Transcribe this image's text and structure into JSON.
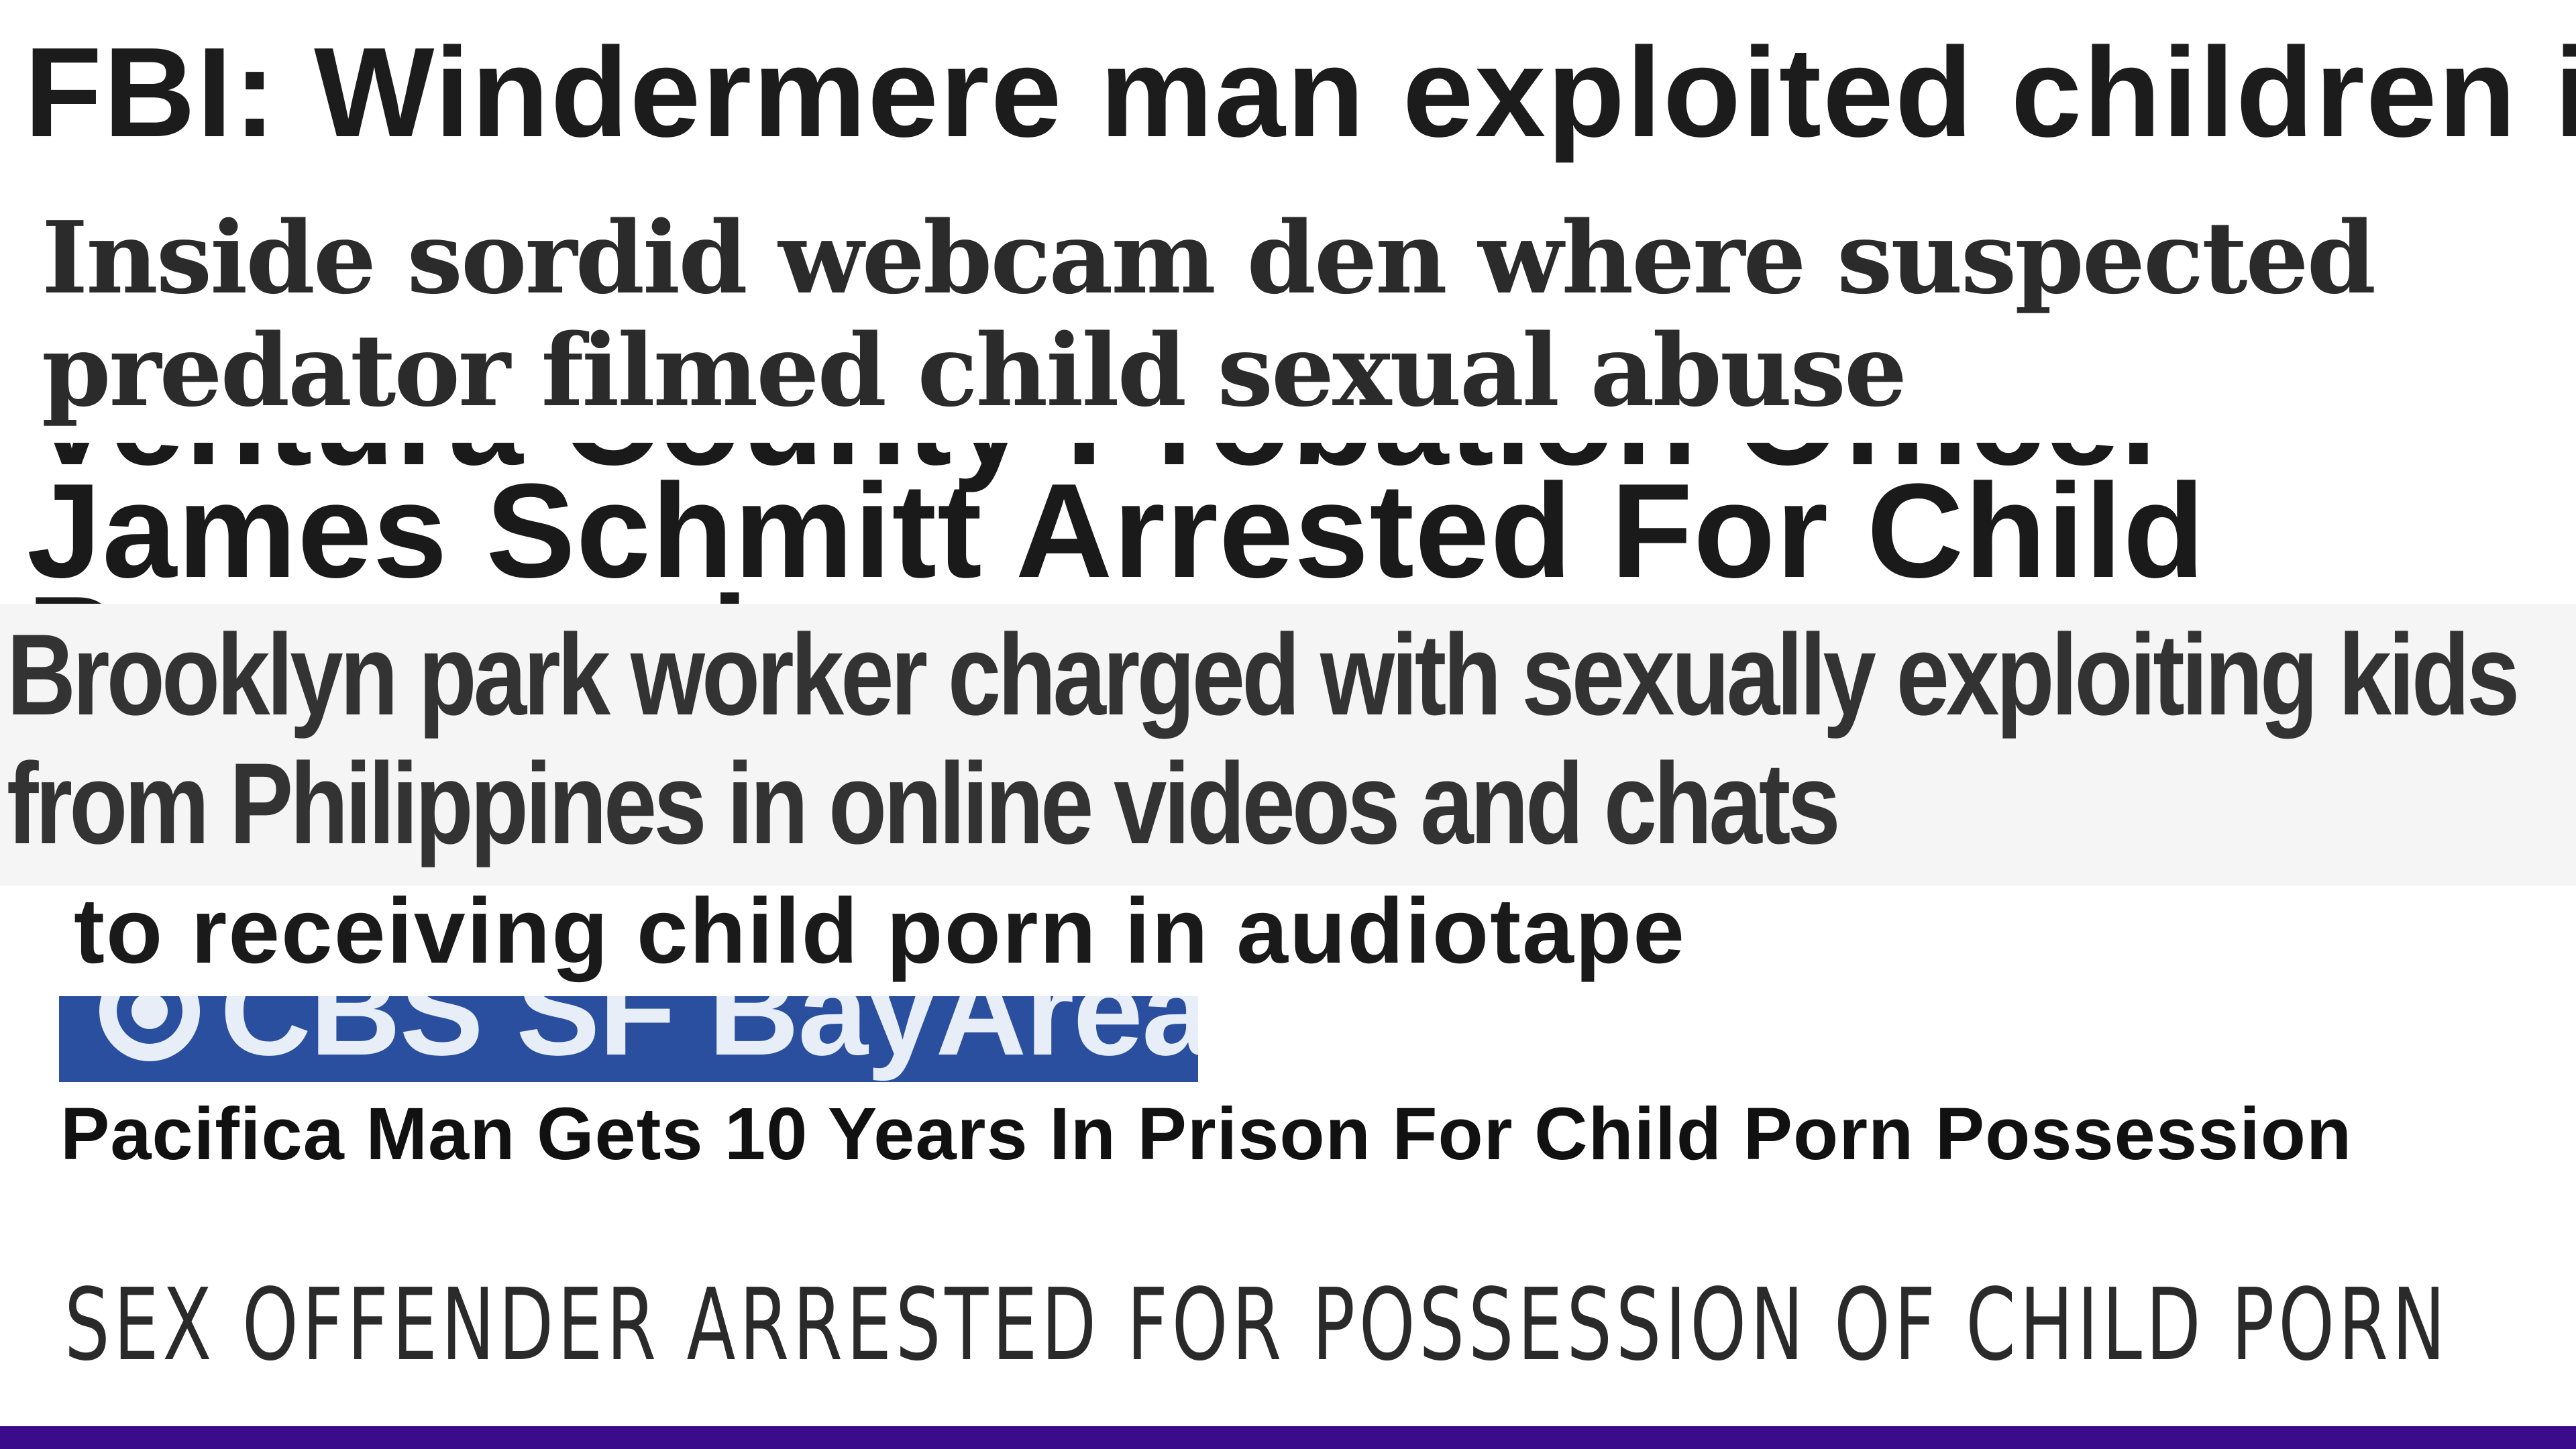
{
  "headlines": {
    "fbi": "FBI: Windermere man exploited children in",
    "webcam": "Inside sordid webcam den where suspected predator filmed child sexual abuse",
    "ventura": "Ventura County Probation Officer James Schmitt Arrested For Child Pornography",
    "brooklyn": "Brooklyn park worker charged with sexually exploiting kids from Philippines in online videos and chats",
    "audiotape": "to receiving child porn in audiotape",
    "cbs_logo": "CBS SF BayArea",
    "pacifica": "Pacifica Man Gets 10 Years In Prison For Child Porn Possession",
    "sex_offender": "SEX OFFENDER ARRESTED FOR POSSESSION OF CHILD PORN"
  },
  "icons": {
    "cbs": "cbs-eye-icon"
  },
  "colors": {
    "cbs_banner": "#2a4f9e",
    "bottom_bar": "#3a0c8c"
  }
}
